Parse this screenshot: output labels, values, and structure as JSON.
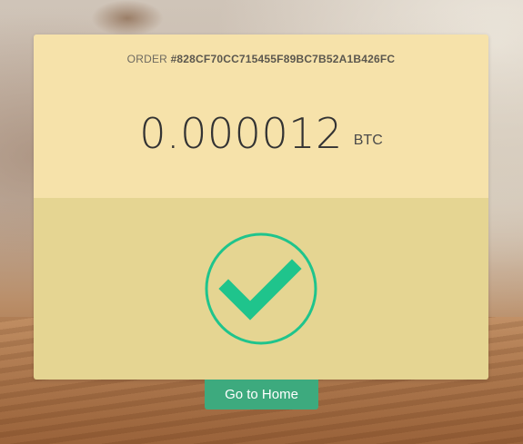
{
  "order": {
    "prefix": "ORDER",
    "id": "#828CF70CC715455F89BC7B52A1B426FC"
  },
  "payment": {
    "amount": "0.000012",
    "currency": "BTC"
  },
  "status": {
    "icon": "checkmark-circle-icon",
    "color": "#1fc48c"
  },
  "actions": {
    "home_label": "Go to Home"
  }
}
